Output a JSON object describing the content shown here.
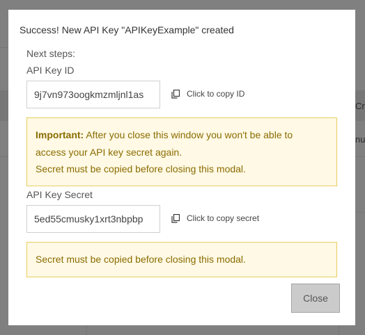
{
  "background": {
    "col_header_fragment": "Crea",
    "cell_fragment": "nur"
  },
  "modal": {
    "title": "Success! New API Key \"APIKeyExample\" created",
    "next_steps": "Next steps:",
    "key_id": {
      "label": "API Key ID",
      "value": "9j7vn973oogkmzmljnl1as",
      "copy_label": "Click to copy ID"
    },
    "important_alert": {
      "strong": "Important:",
      "line1": " After you close this window you won't be able to",
      "line2": "access your API key secret again.",
      "line3": "Secret must be copied before closing this modal."
    },
    "key_secret": {
      "label": "API Key Secret",
      "value": "5ed55cmusky1xrt3nbpbp",
      "copy_label": "Click to copy secret"
    },
    "secret_alert": "Secret must be copied before closing this modal.",
    "close_label": "Close"
  },
  "colors": {
    "overlay": "#808080",
    "alert_bg": "#fff9e5",
    "alert_border": "#e7ce5d",
    "alert_text": "#8a6c00",
    "button_bg": "#cbcbcb"
  }
}
